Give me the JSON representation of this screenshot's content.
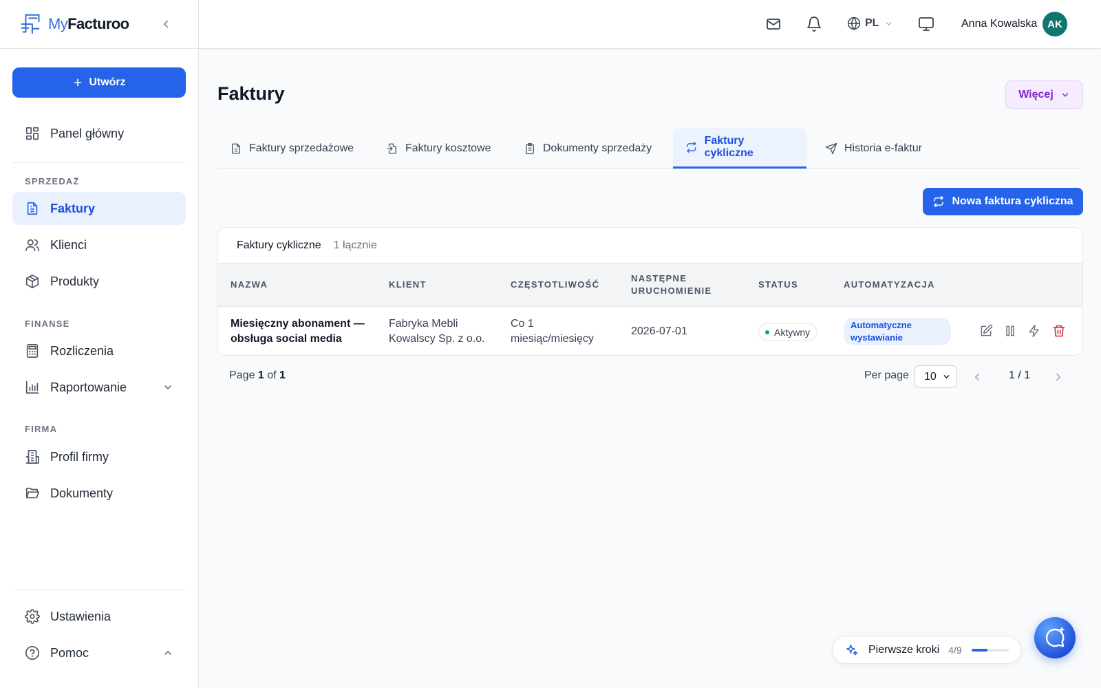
{
  "brand": {
    "my": "My",
    "name": "Facturoo"
  },
  "sidebar": {
    "create_label": "Utwórz",
    "dashboard": "Panel główny",
    "sections": {
      "sales": "SPRZEDAŻ",
      "finance": "FINANSE",
      "company": "FIRMA"
    },
    "items": {
      "invoices": "Faktury",
      "clients": "Klienci",
      "products": "Produkty",
      "settlements": "Rozliczenia",
      "reporting": "Raportowanie",
      "company_profile": "Profil firmy",
      "documents": "Dokumenty",
      "settings": "Ustawienia",
      "help": "Pomoc"
    },
    "active_item": "invoices"
  },
  "topbar": {
    "language": "PL",
    "user_name": "Anna Kowalska",
    "avatar_initials": "AK"
  },
  "main": {
    "title": "Faktury",
    "more_label": "Więcej",
    "tabs": [
      {
        "label": "Faktury sprzedażowe",
        "icon": "file-text-icon"
      },
      {
        "label": "Faktury kosztowe",
        "icon": "file-import-icon"
      },
      {
        "label": "Dokumenty sprzedaży",
        "icon": "clipboard-icon"
      },
      {
        "label": "Faktury cykliczne",
        "icon": "repeat-icon",
        "active": true
      },
      {
        "label": "Historia e-faktur",
        "icon": "send-icon"
      }
    ],
    "new_button": "Nowa faktura cykliczna",
    "table": {
      "title": "Faktury cykliczne",
      "count": "1 łącznie",
      "headers": {
        "name": "NAZWA",
        "client": "KLIENT",
        "frequency": "CZĘSTOTLIWOŚĆ",
        "next_run_1": "NASTĘPNE",
        "next_run_2": "URUCHOMIENIE",
        "status": "STATUS",
        "automation": "AUTOMATYZACJA"
      },
      "rows": [
        {
          "name_1": "Miesięczny abonament —",
          "name_2": "obsługa social media",
          "client_1": "Fabryka Mebli",
          "client_2": "Kowalscy Sp. z o.o.",
          "frequency_1": "Co 1",
          "frequency_2": "miesiąc/miesięcy",
          "next_run": "2026-07-01",
          "status": "Aktywny",
          "automation_1": "Automatyczne",
          "automation_2": "wystawianie"
        }
      ]
    },
    "pager": {
      "page_prefix": "Page",
      "page_current": "1",
      "page_of": "of",
      "page_total": "1",
      "per_page_label": "Per page",
      "per_page_value": "10",
      "position": "1 / 1"
    }
  },
  "widgets": {
    "first_steps_label": "Pierwsze kroki",
    "first_steps_count": "4/9",
    "first_steps_progress": 0.44
  },
  "colors": {
    "primary": "#2563eb",
    "active_bg": "#eaf1fe",
    "more_bg": "#f5edfd",
    "more_text": "#7e22ce",
    "status_dot": "#16a34a",
    "danger": "#dc2626",
    "avatar": "#0f766e"
  }
}
